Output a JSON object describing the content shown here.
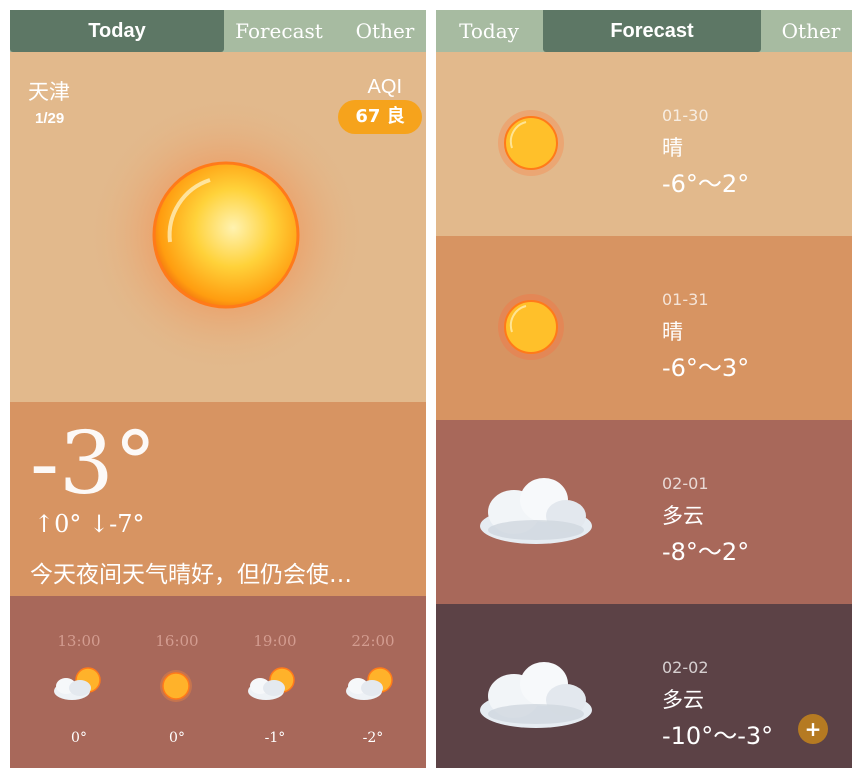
{
  "left": {
    "tabs": [
      {
        "label": "Today",
        "active": true
      },
      {
        "label": "Forecast",
        "active": false
      },
      {
        "label": "Other",
        "active": false
      }
    ],
    "city": "天津",
    "date": "1/29",
    "aqi_label": "AQI",
    "aqi_badge": "67 良",
    "current_temp": "-3°",
    "temp_range": "↑0° ↓-7°",
    "description": "今天夜间天气晴好，但仍会使…",
    "hourly": [
      {
        "time": "13:00",
        "icon": "partly-cloudy-icon",
        "temp": "0°"
      },
      {
        "time": "16:00",
        "icon": "sun-icon",
        "temp": "0°"
      },
      {
        "time": "19:00",
        "icon": "partly-cloudy-icon",
        "temp": "-1°"
      },
      {
        "time": "22:00",
        "icon": "partly-cloudy-icon",
        "temp": "-2°"
      }
    ]
  },
  "right": {
    "tabs": [
      {
        "label": "Today",
        "active": false
      },
      {
        "label": "Forecast",
        "active": true
      },
      {
        "label": "Other",
        "active": false
      }
    ],
    "days": [
      {
        "date": "01-30",
        "condition": "晴",
        "temp": "-6°～2°",
        "icon": "sun-icon",
        "bg": "#e2b98c"
      },
      {
        "date": "01-31",
        "condition": "晴",
        "temp": "-6°～3°",
        "icon": "sun-icon",
        "bg": "#d79462"
      },
      {
        "date": "02-01",
        "condition": "多云",
        "temp": "-8°～2°",
        "icon": "cloud-icon",
        "bg": "#a8685a"
      },
      {
        "date": "02-02",
        "condition": "多云",
        "temp": "-10°～-3°",
        "icon": "cloud-icon",
        "bg": "#5c4246"
      }
    ],
    "add_button": "+"
  },
  "colors": {
    "tab_bar": "#a7bba1",
    "tab_active": "#5d7765",
    "aqi_badge": "#f6a31c",
    "add_button": "#b57a22"
  }
}
